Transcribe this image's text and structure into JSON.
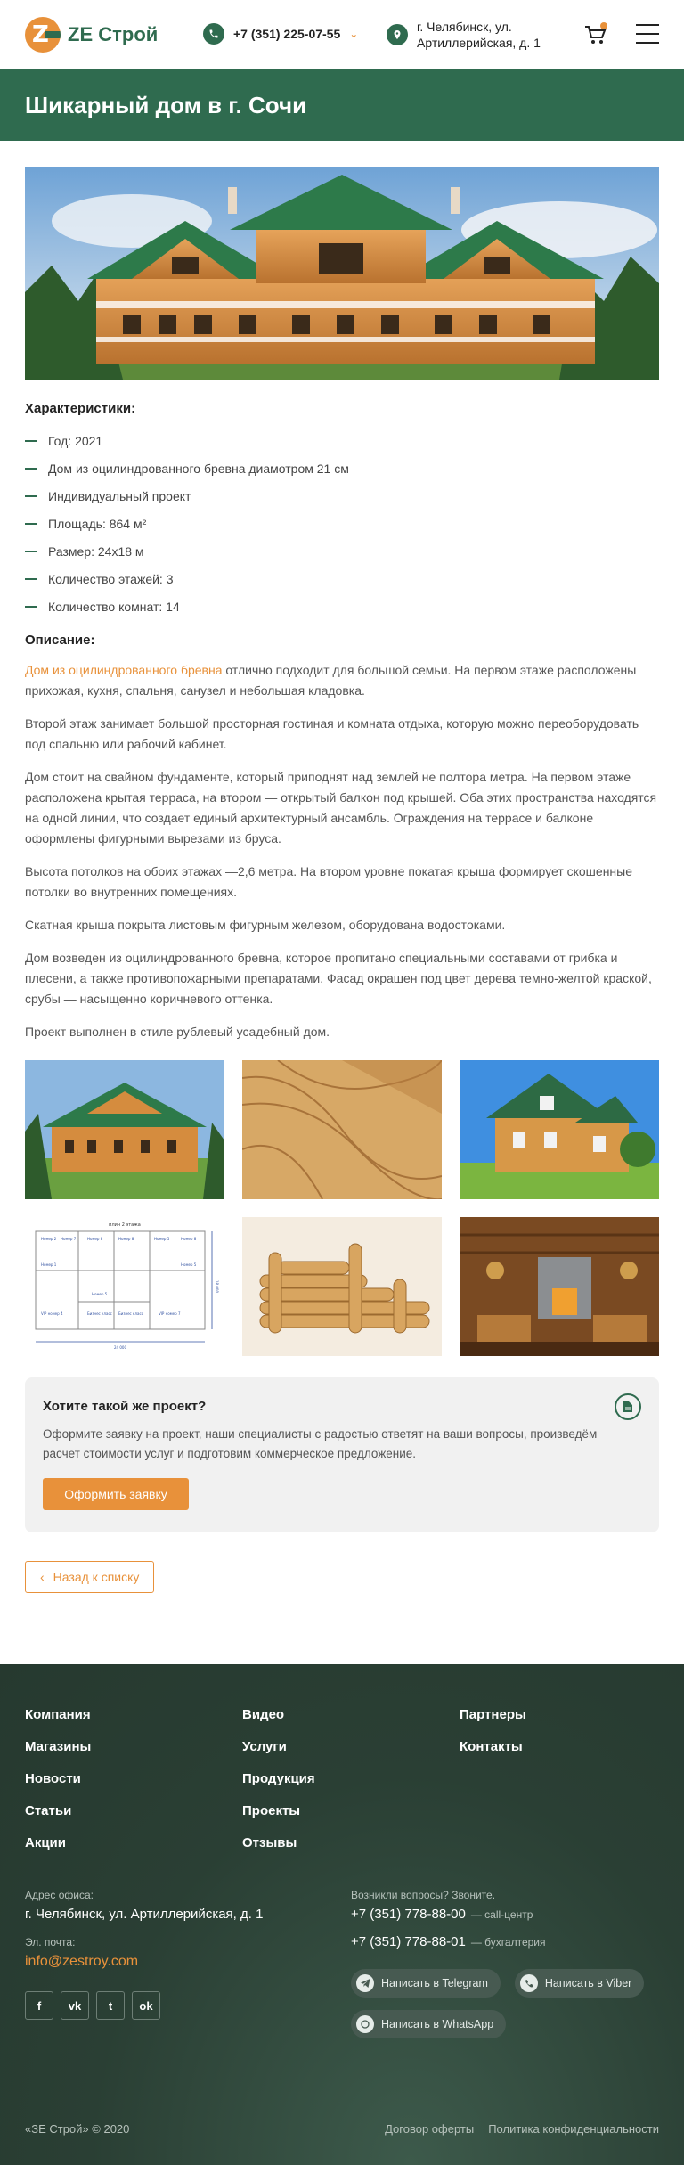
{
  "header": {
    "logo_text": "ZE Строй",
    "phone": "+7 (351) 225-07-55",
    "address": "г. Челябинск, ул. Артиллерийская, д. 1"
  },
  "page": {
    "title": "Шикарный дом в г. Сочи"
  },
  "specs": {
    "heading": "Характеристики:",
    "items": [
      "Год: 2021",
      "Дом из оцилиндрованного бревна диамотром 21 см",
      "Индивидуальный проект",
      "Площадь: 864 м²",
      "Размер: 24х18 м",
      "Количество этажей: 3",
      "Количество комнат: 14"
    ]
  },
  "description": {
    "heading": "Описание:",
    "link_text": "Дом из оцилиндрованного бревна",
    "p1_rest": " отлично подходит для большой семьи. На первом этаже расположены прихожая, кухня, спальня, санузел и небольшая кладовка.",
    "p2": "Второй этаж занимает большой просторная гостиная и комната отдыха, которую можно переоборудовать под спальню или рабочий кабинет.",
    "p3": "Дом стоит на свайном фундаменте, который приподнят над землей не полтора метра. На первом этаже расположена крытая терраса, на втором — открытый балкон под крышей. Оба этих пространства находятся на одной линии, что создает единый архитектурный ансамбль. Ограждения на террасе и балконе оформлены фигурными вырезами из бруса.",
    "p4": "Высота потолков на обоих этажах —2,6 метра. На втором уровне покатая крыша формирует скошенные потолки во внутренних помещениях.",
    "p5": "Скатная крыша покрыта листовым фигурным железом, оборудована водостоками.",
    "p6": "Дом возведен из оцилиндрованного бревна, которое пропитано специальными составами от грибка и плесени, а также противопожарными препаратами. Фасад окрашен под цвет дерева темно-желтой краской, срубы — насыщенно коричневого оттенка.",
    "p7": "Проект выполнен в стиле рублевый усадебный дом."
  },
  "floorplan": {
    "title": "плин 2 этажа",
    "rooms": [
      "Номер 2",
      "Номер 7",
      "Номер 8",
      "Номер 8",
      "Номер 5",
      "Номер 8",
      "Номер 1",
      "Номер 5",
      "VIP номер 4",
      "Номер 5",
      "VIP номер 7",
      "Бизнес класс",
      "Бизнес класс"
    ],
    "dims": [
      "24 000",
      "18 000"
    ]
  },
  "cta": {
    "title": "Хотите такой же проект?",
    "text": "Оформите заявку на проект, наши специалисты с радостью ответят на ваши вопросы, произведём расчет стоимости услуг и подготовим коммерческое предложение.",
    "button": "Оформить заявку"
  },
  "back_button": "Назад к списку",
  "footer": {
    "nav": [
      "Компания",
      "Видео",
      "Партнеры",
      "Магазины",
      "Услуги",
      "Контакты",
      "Новости",
      "Продукция",
      "",
      "Статьи",
      "Проекты",
      "",
      "Акции",
      "Отзывы",
      ""
    ],
    "office_label": "Адрес офиса:",
    "office_value": "г. Челябинск, ул. Артиллерийская, д. 1",
    "email_label": "Эл. почта:",
    "email": "info@zestroy.com",
    "socials": [
      "f",
      "vk",
      "t",
      "ok"
    ],
    "contacts_label": "Возникли вопросы? Звоните.",
    "phone1": "+7 (351) 778-88-00",
    "phone1_note": "— call-центр",
    "phone2": "+7 (351) 778-88-01",
    "phone2_note": "— бухгалтерия",
    "messengers": [
      "Написать в Telegram",
      "Написать в Viber",
      "Написать в WhatsApp"
    ],
    "copyright": "«ЗЕ Строй» © 2020",
    "offer": "Договор оферты",
    "privacy": "Политика конфиденциальности"
  },
  "colors": {
    "brand_green": "#2f6b4f",
    "accent_orange": "#e8913a"
  }
}
